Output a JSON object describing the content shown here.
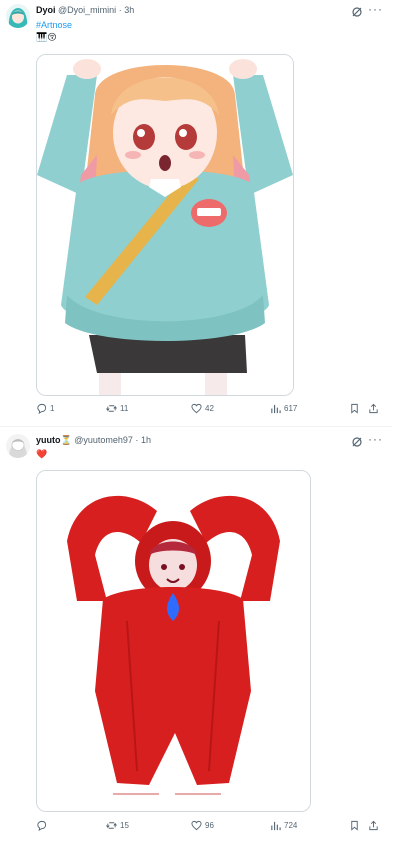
{
  "posts": [
    {
      "display_name": "Dyoi",
      "handle": "@Dyoi_mimini",
      "separator": "·",
      "time": "3h",
      "hashtag": "#Artnose",
      "emoji": "🎹😚",
      "more_label": "···",
      "stats": {
        "replies": "1",
        "reposts": "11",
        "likes": "42",
        "views": "617"
      }
    },
    {
      "display_name": "yuuto",
      "name_emoji": "⏳",
      "handle": "@yuutomeh97",
      "separator": "·",
      "time": "1h",
      "emoji": "❤️",
      "more_label": "···",
      "stats": {
        "replies": "",
        "reposts": "15",
        "likes": "96",
        "views": "724"
      }
    }
  ],
  "colors": {
    "text": "#0f1419",
    "muted": "#536471",
    "link": "#1d9bf0",
    "border": "#cfd9de"
  }
}
